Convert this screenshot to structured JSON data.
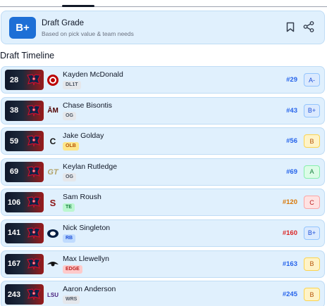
{
  "grade_card": {
    "grade": "B+",
    "title": "Draft Grade",
    "subtitle": "Based on pick value & team needs",
    "badge_color": "#1d6fd6"
  },
  "section_title": "Draft Timeline",
  "picks": [
    {
      "pick": "28",
      "player": "Kayden McDonald",
      "position": "DL1T",
      "rank": "#29",
      "grade": "A-",
      "school_icon": "ohio-state-logo",
      "rank_color": "#2563eb",
      "grade_tone": "blue"
    },
    {
      "pick": "38",
      "player": "Chase Bisontis",
      "position": "OG",
      "rank": "#43",
      "grade": "B+",
      "school_icon": "texas-am-logo",
      "rank_color": "#2563eb",
      "grade_tone": "blue"
    },
    {
      "pick": "59",
      "player": "Jake Golday",
      "position": "OLB",
      "rank": "#56",
      "grade": "B",
      "school_icon": "cincinnati-logo",
      "rank_color": "#2563eb",
      "grade_tone": "orange"
    },
    {
      "pick": "69",
      "player": "Keylan Rutledge",
      "position": "OG",
      "rank": "#69",
      "grade": "A",
      "school_icon": "georgia-tech-logo",
      "rank_color": "#2563eb",
      "grade_tone": "green"
    },
    {
      "pick": "106",
      "player": "Sam Roush",
      "position": "TE",
      "rank": "#120",
      "grade": "C",
      "school_icon": "stanford-logo",
      "rank_color": "#d97706",
      "grade_tone": "red"
    },
    {
      "pick": "141",
      "player": "Nick Singleton",
      "position": "RB",
      "rank": "#160",
      "grade": "B+",
      "school_icon": "penn-state-logo",
      "rank_color": "#dc2626",
      "grade_tone": "blue"
    },
    {
      "pick": "167",
      "player": "Max Llewellyn",
      "position": "EDGE",
      "rank": "#163",
      "grade": "B",
      "school_icon": "iowa-logo",
      "rank_color": "#2563eb",
      "grade_tone": "orange"
    },
    {
      "pick": "243",
      "player": "Aaron Anderson",
      "position": "WRS",
      "rank": "#245",
      "grade": "B",
      "school_icon": "lsu-logo",
      "rank_color": "#2563eb",
      "grade_tone": "orange"
    }
  ],
  "school_glyphs": {
    "texas-am-logo": "ĀM",
    "cincinnati-logo": "C",
    "stanford-logo": "S",
    "lsu-logo": "LSU"
  }
}
